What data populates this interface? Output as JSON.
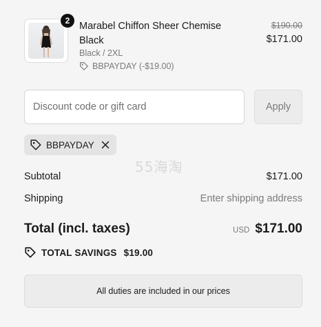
{
  "line_item": {
    "quantity": "2",
    "title": "Marabel Chiffon Sheer Chemise Black",
    "variant": "Black / 2XL",
    "discount_text": "BBPAYDAY (-$19.00)",
    "original_price": "$190.00",
    "price": "$171.00",
    "thumbnail_icon": "product-photo"
  },
  "discount": {
    "placeholder": "Discount code or gift card",
    "value": "",
    "apply_label": "Apply"
  },
  "applied_code": {
    "label": "BBPAYDAY",
    "icon": "tag-icon",
    "remove_icon": "close-icon"
  },
  "watermark": "55海淘",
  "summary": {
    "subtotal_label": "Subtotal",
    "subtotal_value": "$171.00",
    "shipping_label": "Shipping",
    "shipping_value": "Enter shipping address",
    "total_label": "Total (incl. taxes)",
    "currency": "USD",
    "total_value": "$171.00",
    "savings_label": "TOTAL SAVINGS",
    "savings_value": "$19.00"
  },
  "notice": "All duties are included in our prices",
  "colors": {
    "background": "#f5f5f5",
    "text": "#1a1a1a",
    "muted": "#7a7a7a",
    "badge": "#111111"
  }
}
